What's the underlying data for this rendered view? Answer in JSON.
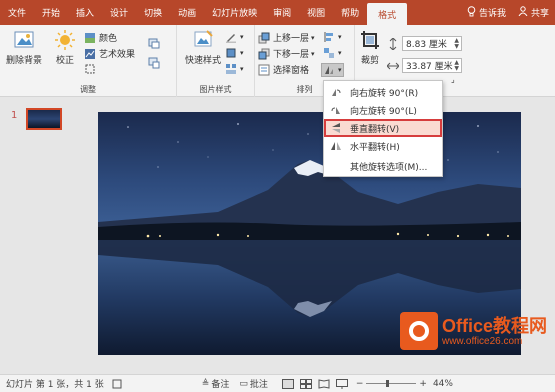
{
  "tabs": [
    "文件",
    "开始",
    "插入",
    "设计",
    "切换",
    "动画",
    "幻灯片放映",
    "审阅",
    "视图",
    "帮助",
    "格式"
  ],
  "active_tab": "格式",
  "tell_me": "告诉我",
  "share": "共享",
  "ribbon": {
    "remove_bg": "删除背景",
    "corrections": "校正",
    "color": "颜色",
    "artistic": "艺术效果",
    "adjust_label": "调整",
    "quick_styles": "快速样式",
    "picture_styles_label": "图片样式",
    "bring_forward": "上移一层",
    "send_backward": "下移一层",
    "selection_pane": "选择窗格",
    "arrange_label": "排列",
    "crop": "裁剪",
    "height_value": "8.83 厘米",
    "width_value": "33.87 厘米"
  },
  "menu": {
    "rotate_right": "向右旋转 90°(R)",
    "rotate_left": "向左旋转 90°(L)",
    "flip_vertical": "垂直翻转(V)",
    "flip_horizontal": "水平翻转(H)",
    "more_options": "其他旋转选项(M)..."
  },
  "slide_number": "1",
  "status": {
    "slide_info": "幻灯片 第 1 张，共 1 张",
    "notes": "备注",
    "comments": "批注",
    "zoom": "44%"
  },
  "watermark": {
    "title": "Office教程网",
    "url": "www.office26.com"
  },
  "colors": {
    "accent": "#b7472a",
    "highlight_border": "#d63d3d",
    "watermark": "#e85a1e"
  }
}
